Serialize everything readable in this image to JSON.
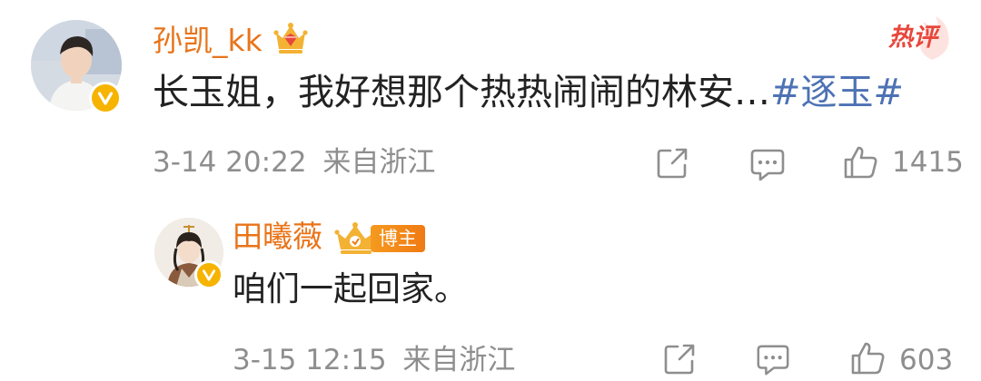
{
  "comment": {
    "username": "孙凯_kk",
    "text_main": "长玉姐，我好想那个热热闹闹的林安…",
    "hashtag": "#逐玉#",
    "hot_label": "热评",
    "timestamp": "3-14 20:22",
    "location": "来自浙江",
    "like_count": "1415",
    "badge_icon": "crown-diamond-icon",
    "verified": true
  },
  "reply": {
    "username": "田曦薇",
    "text": "咱们一起回家。",
    "badge_label": "博主",
    "timestamp": "3-15 12:15",
    "location": "来自浙江",
    "like_count": "603",
    "verified": true
  },
  "colors": {
    "username": "#e9741a",
    "hashtag": "#4d72b4",
    "meta": "#8e8e8e",
    "hot": "#e8473b",
    "verify_badge": "#f6b400"
  }
}
